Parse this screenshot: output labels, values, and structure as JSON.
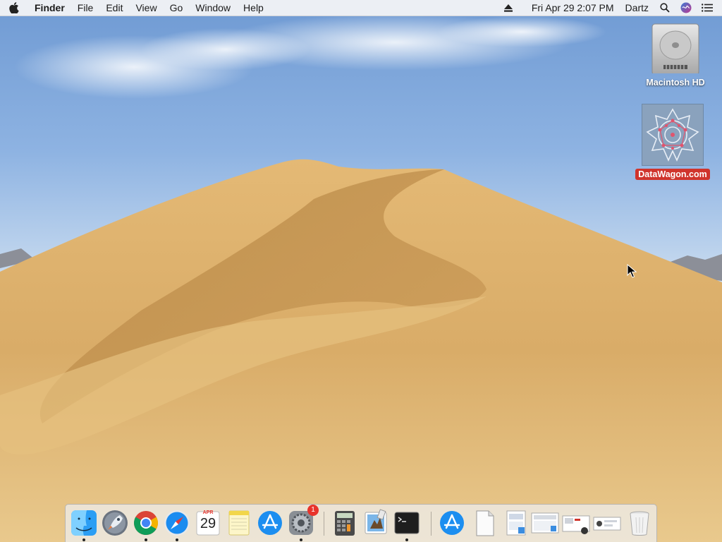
{
  "menubar": {
    "app_name": "Finder",
    "menus": [
      "File",
      "Edit",
      "View",
      "Go",
      "Window",
      "Help"
    ],
    "datetime": "Fri Apr 29  2:07 PM",
    "user": "Dartz",
    "icons": [
      "apple-icon",
      "eject-icon",
      "spotlight-search-icon",
      "siri-icon",
      "notification-center-icon"
    ]
  },
  "desktop": {
    "items": [
      {
        "label": "Macintosh HD",
        "icon": "hard-drive-icon"
      },
      {
        "label": "DataWagon.com",
        "icon": "datawagon-image-icon",
        "selected": true
      }
    ]
  },
  "dock": {
    "apps": [
      {
        "name": "Finder",
        "icon": "finder-icon",
        "running": true
      },
      {
        "name": "Launchpad",
        "icon": "launchpad-icon",
        "running": false
      },
      {
        "name": "Google Chrome",
        "icon": "chrome-icon",
        "running": true
      },
      {
        "name": "Safari",
        "icon": "safari-icon",
        "running": true
      },
      {
        "name": "Calendar",
        "icon": "calendar-icon",
        "running": false,
        "month": "APR",
        "day": "29"
      },
      {
        "name": "Notes",
        "icon": "notes-icon",
        "running": false
      },
      {
        "name": "App Store",
        "icon": "app-store-icon",
        "running": false
      },
      {
        "name": "System Preferences",
        "icon": "system-preferences-icon",
        "running": true,
        "badge": "1"
      },
      {
        "name": "Calculator",
        "icon": "calculator-icon",
        "running": false
      },
      {
        "name": "Preview",
        "icon": "preview-icon",
        "running": false
      },
      {
        "name": "Terminal",
        "icon": "terminal-icon",
        "running": true
      },
      {
        "name": "Applications",
        "icon": "applications-folder-icon"
      },
      {
        "name": "Document",
        "icon": "document-icon"
      },
      {
        "name": "Screenshot 1",
        "icon": "screenshot-icon"
      },
      {
        "name": "Screenshot 2",
        "icon": "screenshot-icon"
      },
      {
        "name": "Screenshot 3",
        "icon": "screenshot-icon"
      },
      {
        "name": "Screenshot 4",
        "icon": "screenshot-icon"
      },
      {
        "name": "Trash",
        "icon": "trash-icon"
      }
    ]
  },
  "colors": {
    "sky_top": "#6f9ad3",
    "sand": "#d8ad6a",
    "selection_red": "#d0342c"
  }
}
